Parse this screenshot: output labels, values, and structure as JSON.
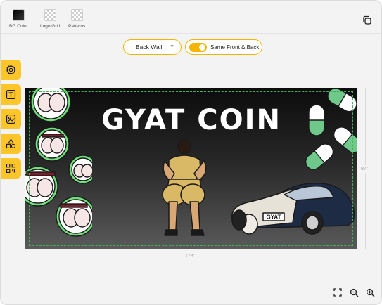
{
  "toolbar": {
    "tools": [
      {
        "label": "BG Color",
        "icon": "bg-color-swatch"
      },
      {
        "label": "Logo Grid",
        "icon": "checker-pattern"
      },
      {
        "label": "Patterns",
        "icon": "checker-pattern"
      }
    ],
    "copy_icon": "copy-icon"
  },
  "sidebar": {
    "items": [
      {
        "icon": "settings-gear-icon"
      },
      {
        "icon": "text-icon"
      },
      {
        "icon": "image-icon"
      },
      {
        "icon": "shapes-icon"
      },
      {
        "icon": "qr-code-icon"
      }
    ],
    "accent": "#fcc52a"
  },
  "controls": {
    "wall_select": {
      "value": "Back Wall"
    },
    "same_front_back": {
      "label": "Same Front & Back",
      "on": true
    }
  },
  "design": {
    "headline": "GYAT COIN",
    "plate": "GYAT",
    "background": "#1a1a1a",
    "guide_color": "#3fb356"
  },
  "dimensions": {
    "width": "178\"",
    "height": "87\""
  },
  "zoom_controls": [
    "fit-screen-icon",
    "zoom-out-icon",
    "zoom-in-icon"
  ]
}
